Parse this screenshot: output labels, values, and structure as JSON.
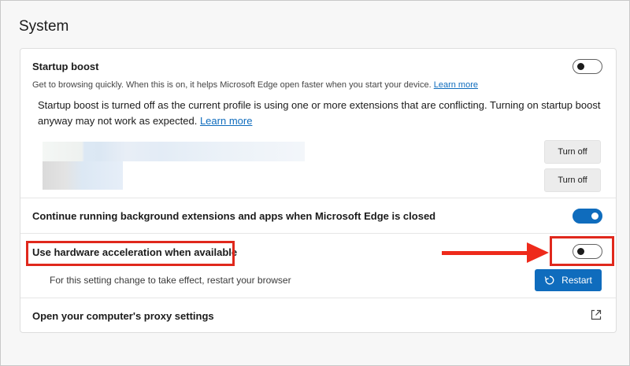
{
  "page": {
    "title": "System"
  },
  "startup_boost": {
    "title": "Startup boost",
    "description": "Get to browsing quickly. When this is on, it helps Microsoft Edge open faster when you start your device.",
    "learn_more": "Learn more",
    "toggle_state": "off",
    "warning_line1": "Startup boost is turned off as the current profile is using one or more extensions that are conflicting. Turning on startup boost",
    "warning_line2": "anyway may not work as expected.",
    "warning_learn_more": "Learn more",
    "turn_off_1": "Turn off",
    "turn_off_2": "Turn off"
  },
  "background_extensions": {
    "title": "Continue running background extensions and apps when Microsoft Edge is closed",
    "toggle_state": "on"
  },
  "hardware_acceleration": {
    "title": "Use hardware acceleration when available",
    "toggle_state": "off",
    "restart_note": "For this setting change to take effect, restart your browser",
    "restart_label": "Restart"
  },
  "proxy": {
    "title": "Open your computer's proxy settings"
  },
  "colors": {
    "accent": "#0f6cbd",
    "annotation": "#e0281c"
  }
}
